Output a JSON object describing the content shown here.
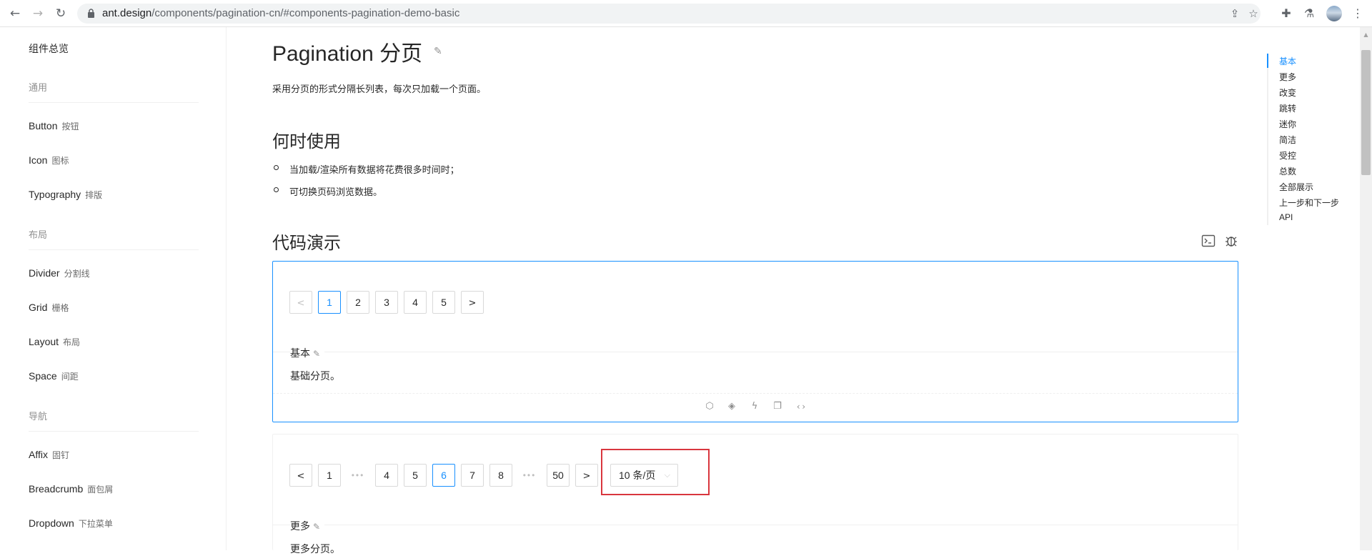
{
  "browser": {
    "url_host": "ant.design",
    "url_path": "/components/pagination-cn/#components-pagination-demo-basic",
    "back_icon": "←",
    "forward_icon": "→",
    "reload_icon": "↻",
    "share_icon": "⇪",
    "bookmark_icon": "☆",
    "puzzle_icon": "✚",
    "flask_icon": "⚗",
    "menu_icon": "⋮"
  },
  "sidebar": {
    "overview": "组件总览",
    "groups": [
      {
        "label": "通用"
      },
      {
        "label": "布局"
      },
      {
        "label": "导航"
      }
    ],
    "items": [
      {
        "en": "Button",
        "zh": "按钮"
      },
      {
        "en": "Icon",
        "zh": "图标"
      },
      {
        "en": "Typography",
        "zh": "排版"
      },
      {
        "en": "Divider",
        "zh": "分割线"
      },
      {
        "en": "Grid",
        "zh": "栅格"
      },
      {
        "en": "Layout",
        "zh": "布局"
      },
      {
        "en": "Space",
        "zh": "间距"
      },
      {
        "en": "Affix",
        "zh": "固钉"
      },
      {
        "en": "Breadcrumb",
        "zh": "面包屑"
      },
      {
        "en": "Dropdown",
        "zh": "下拉菜单"
      }
    ]
  },
  "main": {
    "title": "Pagination 分页",
    "intro": "采用分页的形式分隔长列表，每次只加载一个页面。",
    "when_heading": "何时使用",
    "when_items": [
      "当加载/渲染所有数据将花费很多时间时；",
      "可切换页码浏览数据。"
    ],
    "demo_heading": "代码演示"
  },
  "demo_basic": {
    "prev": "<",
    "next": ">",
    "pages": [
      "1",
      "2",
      "3",
      "4",
      "5"
    ],
    "current": "1",
    "title": "基本",
    "description": "基础分页。"
  },
  "demo_more": {
    "prev": "<",
    "next": ">",
    "ellipsis": "•••",
    "pages": [
      "1",
      "4",
      "5",
      "6",
      "7",
      "8",
      "50"
    ],
    "current": "6",
    "page_size": "10 条/页",
    "title": "更多",
    "description": "更多分页。"
  },
  "anchor": {
    "links": [
      "基本",
      "更多",
      "改变",
      "跳转",
      "迷你",
      "简洁",
      "受控",
      "总数",
      "全部展示",
      "上一步和下一步",
      "API"
    ],
    "active": "基本"
  },
  "colors": {
    "primary": "#1890ff",
    "highlight": "#d9363e"
  }
}
